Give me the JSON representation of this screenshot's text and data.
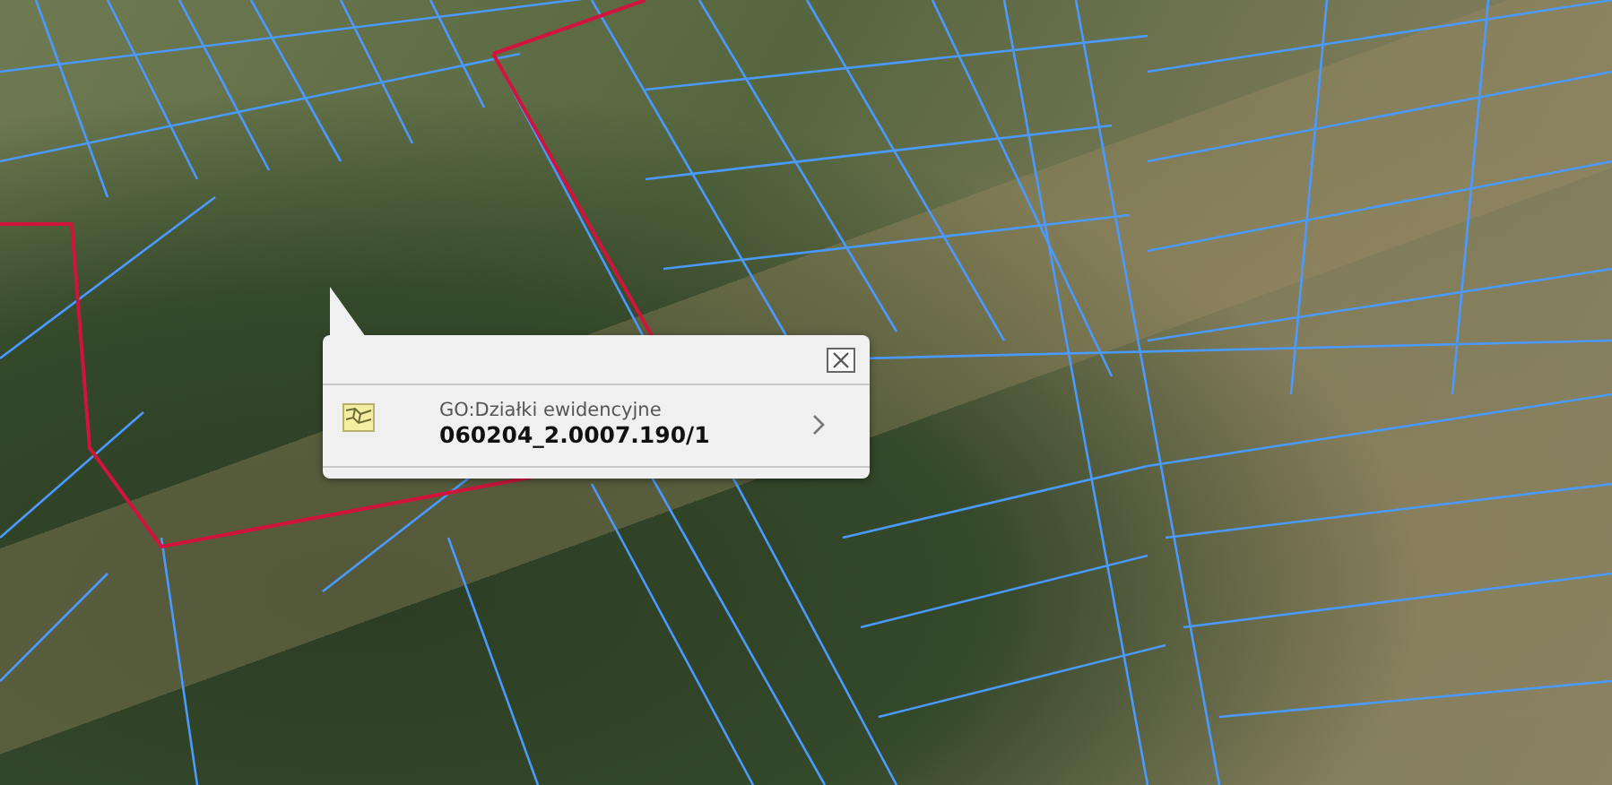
{
  "popup": {
    "layer": "GO:Działki ewidencyjne",
    "parcel_id": "060204_2.0007.190/1"
  }
}
